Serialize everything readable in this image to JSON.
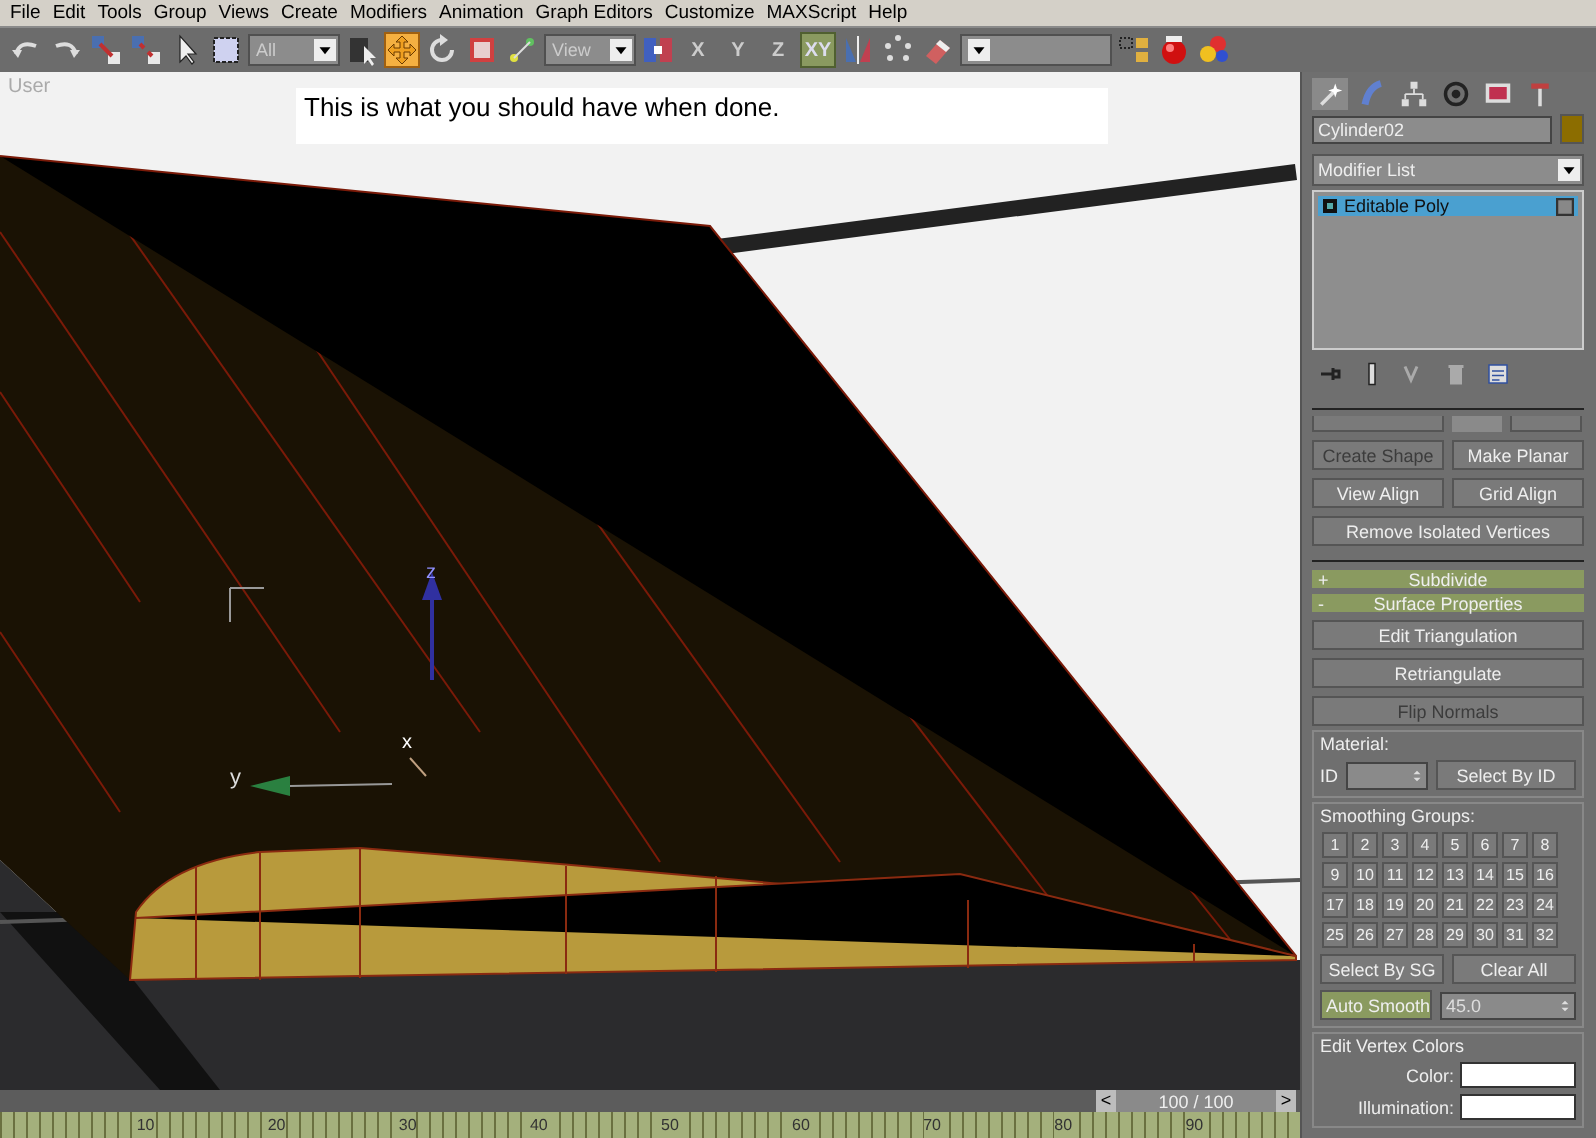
{
  "menu": [
    "File",
    "Edit",
    "Tools",
    "Group",
    "Views",
    "Create",
    "Modifiers",
    "Animation",
    "Graph Editors",
    "Customize",
    "MAXScript",
    "Help"
  ],
  "toolbar": [
    {
      "kind": "icon",
      "selected": false
    },
    {
      "kind": "icon",
      "selected": false
    },
    {
      "kind": "icon",
      "selected": false
    },
    {
      "kind": "icon",
      "selected": false
    },
    {
      "kind": "icon",
      "selected": false
    },
    {
      "kind": "icon",
      "selected": false
    },
    {
      "kind": "dropdown",
      "value": "All"
    },
    {
      "kind": "icon",
      "selected": false
    },
    {
      "kind": "icon",
      "selected": true
    },
    {
      "kind": "icon",
      "selected": false
    },
    {
      "kind": "icon",
      "selected": false
    },
    {
      "kind": "icon",
      "selected": false
    },
    {
      "kind": "dropdown",
      "value": "View"
    },
    {
      "kind": "icon",
      "selected": false
    },
    {
      "kind": "axis",
      "label": "X",
      "selected": false
    },
    {
      "kind": "axis",
      "label": "Y",
      "selected": false
    },
    {
      "kind": "axis",
      "label": "Z",
      "selected": false
    },
    {
      "kind": "axis",
      "label": "XY",
      "selected": true
    },
    {
      "kind": "icon",
      "selected": false
    },
    {
      "kind": "icon",
      "selected": false
    },
    {
      "kind": "icon",
      "selected": false
    },
    {
      "kind": "dropdown"
    },
    {
      "kind": "icon",
      "selected": false
    },
    {
      "kind": "icon",
      "selected": false
    },
    {
      "kind": "icon",
      "selected": false
    }
  ],
  "viewport": {
    "label": "User",
    "note": "This is what you should have when done.",
    "gizmo_labels": [
      "z",
      "y",
      "x"
    ]
  },
  "time_slider": {
    "prev": "<",
    "position": "100 / 100",
    "next": ">",
    "level": 1
  },
  "track_bar": {
    "ticks": [
      "10",
      "20",
      "30",
      "40",
      "50",
      "60",
      "70",
      "80",
      "90"
    ]
  },
  "command_panel": {
    "tabs": [
      {
        "selected": true
      },
      {
        "selected": false
      },
      {
        "selected": false
      },
      {
        "selected": false
      },
      {
        "selected": false
      },
      {
        "selected": false
      }
    ],
    "object_name": "Cylinder02",
    "modifier_list": "Modifier List",
    "stack": [
      {
        "label": "Editable Poly",
        "selected": true
      }
    ],
    "geometry_buttons": [
      [
        {
          "label": "Create Shape",
          "disabled": true
        },
        {
          "label": "Make Planar",
          "disabled": false
        }
      ],
      [
        {
          "label": "View Align",
          "disabled": false
        },
        {
          "label": "Grid Align",
          "disabled": false
        }
      ],
      [
        {
          "label": "Remove Isolated Vertices",
          "disabled": false
        }
      ]
    ],
    "rollouts": [
      {
        "sign": "+",
        "title": "Subdivide"
      },
      {
        "sign": "-",
        "title": "Surface Properties"
      }
    ],
    "surface_buttons": [
      {
        "label": "Edit Triangulation",
        "disabled": false
      },
      {
        "label": "Retriangulate",
        "disabled": false
      },
      {
        "label": "Flip Normals",
        "disabled": true
      }
    ],
    "material": {
      "title": "Material:",
      "id_label": "ID",
      "select_button": "Select By ID"
    },
    "smoothing": {
      "title": "Smoothing Groups:",
      "groups": [
        "1",
        "2",
        "3",
        "4",
        "5",
        "6",
        "7",
        "8",
        "9",
        "10",
        "11",
        "12",
        "13",
        "14",
        "15",
        "16",
        "17",
        "18",
        "19",
        "20",
        "21",
        "22",
        "23",
        "24",
        "25",
        "26",
        "27",
        "28",
        "29",
        "30",
        "31",
        "32"
      ],
      "select_button": "Select By SG",
      "clear_button": "Clear All",
      "auto_smooth": {
        "label": "Auto Smooth",
        "on": true
      },
      "threshold": "45.0"
    },
    "vertex_colors": {
      "title": "Edit Vertex Colors",
      "fields": [
        "Color:",
        "Illumination:"
      ]
    }
  }
}
